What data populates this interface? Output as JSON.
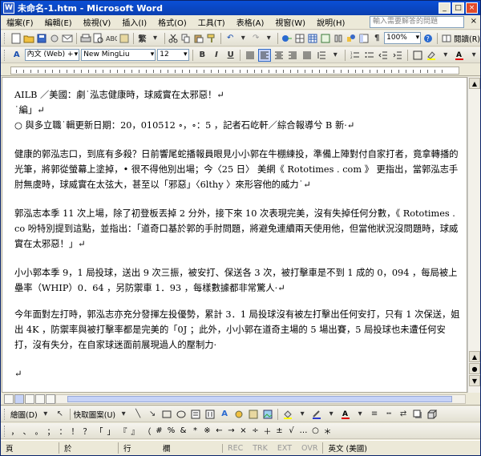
{
  "window": {
    "title": "未命名-1.htm - Microsoft Word",
    "app_icon_letter": "W",
    "minimize": "_",
    "maximize": "□",
    "close": "×"
  },
  "menu": {
    "items": [
      "檔案(F)",
      "編輯(E)",
      "檢視(V)",
      "插入(I)",
      "格式(O)",
      "工具(T)",
      "表格(A)",
      "視窗(W)",
      "說明(H)"
    ],
    "help_placeholder": "輸入需要解答的問題",
    "close": "×"
  },
  "toolbar_standard": {
    "table_label": "繁",
    "zoom": "100%",
    "reading_label": "閱讀(R)"
  },
  "toolbar_format": {
    "style_value": "內文 (Web) +",
    "font_value": "New MingLiu",
    "size_value": "12",
    "bold": "B",
    "italic": "I",
    "underline": "U"
  },
  "document": {
    "paragraphs": [
      "AILB ／美國：劇˙泓志健康時，球威實在太邪惡！↵",
      "˙編」↵",
      "○ 與多立職˙輯更新日期：20，010512 ∘，∘：5 ，記者石屹軒／綜合報導兮 B 新·↵",
      "健康的郭泓志口，到底有多殺？日前響尾蛇播報員眼見小小郭在牛棚練投，準備上陣對付自家打者，竟拿轉播的光筆，將郭從螢幕上塗掉，• 很不得他別出場；今〈25 日〉 美網《 Rototimes . com 》 更指出，當郭泓志手肘無虞時，球威實在太弦大，甚至以「邪惡」〈6lthy 〉來形容他的威力˙↵",
      "郭泓志本季 11 次上場，除了初登板丟掉 2 分外，接下來 10 次表現完美，沒有失掉任何分數，《 Rototimes . co 吩特別提到這點，並指出：「道奇口基於郭的手肘問題，將避免連續兩天使用他，但當他狀況沒問題時，球威實在太邪惡！」↵",
      "小小郭本季 9，1 局投球，送出 9 次三振，被安打、保送各 3 次，被打擊車是不到 1 成的 0，094 ，每局被上壘率（WHIP）0．64 ，另防禦車 1．93 ，每樣數據都非常驚人·↵",
      "今年面對左打時，郭泓志亦充分發揮左投優勢，累計 3．1 局投球沒有被左打擊出任何安打，只有 1 次保送，姐出 4K ，防禦率與被打擊率都是完美的「0J ；此外，小小郭在道奇主場的 5 場出賽，5 局投球也未遭任何安打，沒有失分，在自家球迷面前展現過人的壓制力·",
      "↵"
    ]
  },
  "drawing_toolbar": {
    "draw_label": "繪圖(D)",
    "autoshapes_label": "快取圖案(U)"
  },
  "symbols": [
    "，",
    "、",
    "。",
    "；",
    "：",
    "！",
    "？",
    "「",
    "」",
    "『",
    "』",
    "（",
    "#",
    "%",
    "&",
    "*",
    "※",
    "←",
    "→",
    "×",
    "÷",
    "＋",
    "±",
    "√",
    "…",
    "○",
    "＊"
  ],
  "status": {
    "page": "頁",
    "section": "於",
    "line": "行",
    "column": "欄",
    "rec": "REC",
    "trk": "TRK",
    "ext": "EXT",
    "ovr": "OVR",
    "language": "英文 (美國)"
  }
}
